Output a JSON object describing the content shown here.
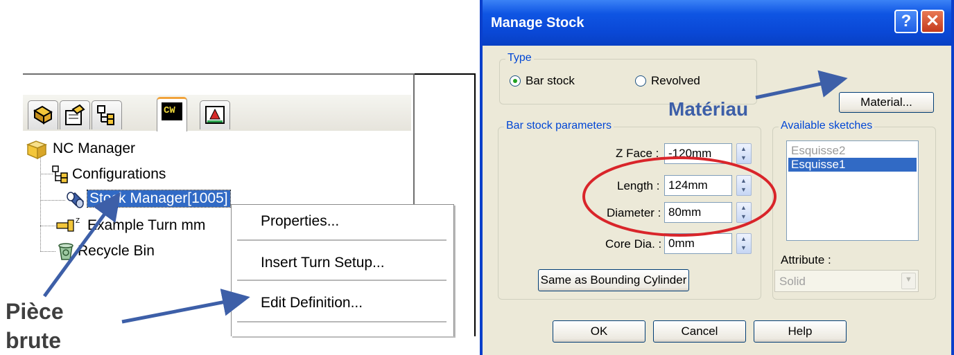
{
  "tree_panel": {
    "tabs": [
      {
        "name": "feature-manager-icon"
      },
      {
        "name": "property-manager-icon"
      },
      {
        "name": "configuration-manager-icon"
      },
      {
        "name": "camworks-icon",
        "label": "CW"
      },
      {
        "name": "dimxpert-icon"
      }
    ],
    "items": {
      "root": "NC Manager",
      "configurations": "Configurations",
      "stock_manager": "Stock Manager[1005]",
      "setup": "Example Turn mm",
      "recycle": "Recycle Bin"
    }
  },
  "context_menu": {
    "items": [
      "Properties...",
      "Insert Turn Setup...",
      "Edit Definition..."
    ]
  },
  "annotations": {
    "piece_brute_line1": "Pièce",
    "piece_brute_line2": "brute",
    "materiau": "Matériau",
    "arrow_color": "#3d5fa8",
    "ellipse_color": "#d9252a"
  },
  "dialog": {
    "title": "Manage Stock",
    "help_button": "?",
    "close_button": "✕",
    "type_group": {
      "legend": "Type",
      "bar_stock": "Bar stock",
      "revolved": "Revolved",
      "selected": "Bar stock"
    },
    "material_button": "Material...",
    "params_group": {
      "legend": "Bar stock parameters",
      "z_face_label": "Z Face :",
      "z_face_value": "-120mm",
      "length_label": "Length :",
      "length_value": "124mm",
      "diameter_label": "Diameter :",
      "diameter_value": "80mm",
      "core_label": "Core Dia. :",
      "core_value": "0mm",
      "same_button": "Same as Bounding Cylinder"
    },
    "sketches_group": {
      "legend": "Available sketches",
      "items": [
        "Esquisse2",
        "Esquisse1"
      ],
      "selected": "Esquisse1",
      "attribute_label": "Attribute :",
      "attribute_value": "Solid"
    },
    "buttons": {
      "ok": "OK",
      "cancel": "Cancel",
      "help": "Help"
    },
    "colors": {
      "title_blue": "#0a48d6",
      "legend_blue": "#0046d5",
      "face": "#ece9d8"
    }
  }
}
